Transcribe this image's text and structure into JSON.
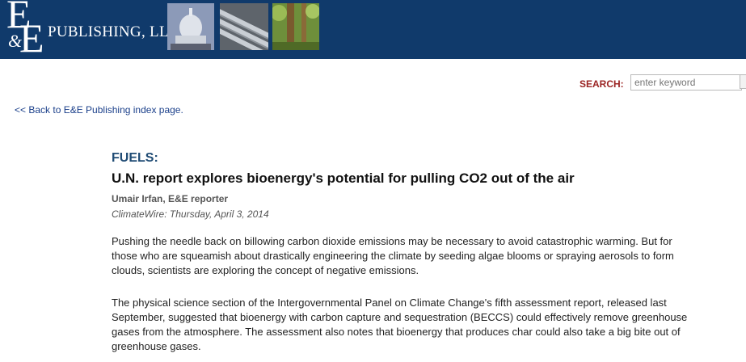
{
  "header": {
    "logo_letters": "E&E",
    "logo_text": "PUBLISHING, LLC",
    "photos": [
      "capitol-dome-photo",
      "pipeline-photo",
      "forest-photo"
    ]
  },
  "search": {
    "label": "SEARCH:",
    "placeholder": "enter keyword"
  },
  "nav": {
    "back_link": "<< Back to E&E Publishing index page."
  },
  "article": {
    "section": "FUELS:",
    "headline": "U.N. report explores bioenergy's potential for pulling CO2 out of the air",
    "byline": "Umair Irfan, E&E reporter",
    "dateline": "ClimateWire: Thursday, April 3, 2014",
    "paragraphs": [
      "Pushing the needle back on billowing carbon dioxide emissions may be necessary to avoid catastrophic warming. But for those who are squeamish about drastically engineering the climate by seeding algae blooms or spraying aerosols to form clouds, scientists are exploring the concept of negative emissions.",
      "The physical science section of the Intergovernmental Panel on Climate Change's fifth assessment report, released last September, suggested that bioenergy with carbon capture and sequestration (BECCS) could effectively remove greenhouse gases from the atmosphere. The assessment also notes that bioenergy that produces char could also take a big bite out of greenhouse gases."
    ]
  },
  "colors": {
    "banner": "#103a6b",
    "search_label": "#9b2423",
    "section_label": "#1f4b74",
    "link": "#1a3f8a"
  }
}
